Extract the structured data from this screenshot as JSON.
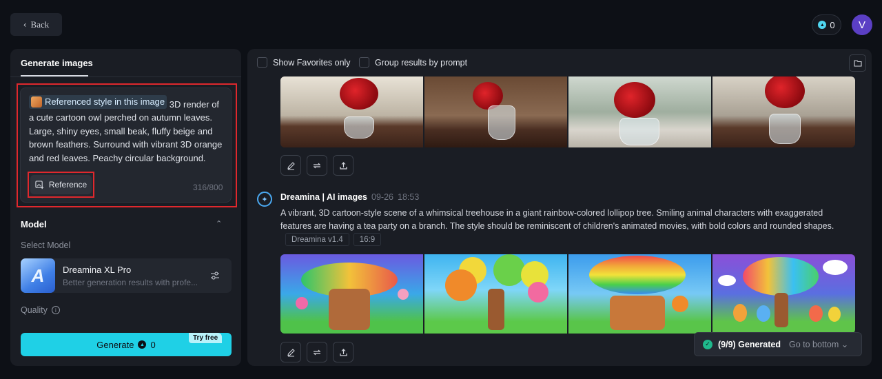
{
  "header": {
    "back_label": "Back",
    "credits": "0",
    "avatar_initial": "V"
  },
  "left_panel": {
    "tab_label": "Generate images",
    "prompt": {
      "reference_chip": "Referenced style in this image",
      "text": "3D render of a cute cartoon owl perched on autumn leaves. Large, shiny eyes, small beak, fluffy beige and brown feathers. Surround with vibrant 3D orange and red leaves. Peachy circular background.",
      "reference_button": "Reference",
      "counter": "316/800"
    },
    "model_section": {
      "title": "Model",
      "select_label": "Select Model",
      "model_name": "Dreamina XL Pro",
      "model_description": "Better generation results with profe...",
      "quality_label": "Quality"
    },
    "generate": {
      "label": "Generate",
      "cost": "0",
      "badge": "Try free"
    }
  },
  "right_panel": {
    "toolbar": {
      "show_favorites": "Show Favorites only",
      "group_results": "Group results by prompt"
    },
    "message": {
      "sender": "Dreamina | AI images",
      "date": "09-26",
      "time": "18:53",
      "text": "A vibrant, 3D cartoon-style scene of a whimsical treehouse in a giant rainbow-colored lollipop tree. Smiling animal characters with exaggerated features are having a tea party on a branch. The style should be reminiscent of children's animated movies, with bold colors and rounded shapes.",
      "tags": [
        "Dreamina v1.4",
        "16:9"
      ]
    },
    "status": {
      "text": "(9/9) Generated",
      "action": "Go to bottom"
    }
  },
  "colors": {
    "accent": "#1fd0e6",
    "highlight_box": "#e0282d",
    "avatar": "#5b3fc4"
  }
}
